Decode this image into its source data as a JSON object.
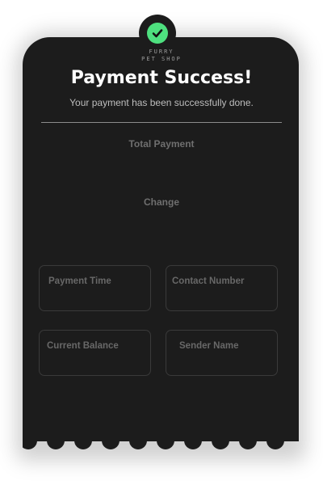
{
  "brand": {
    "line1": "FURRY",
    "line2": "PET SHOP"
  },
  "header": {
    "title": "Payment Success!",
    "subtitle": "Your payment has been successfully done."
  },
  "summary": {
    "total_label": "Total Payment",
    "change_label": "Change"
  },
  "fields": {
    "payment_time": "Payment Time",
    "contact_number": "Contact Number",
    "current_balance": "Current Balance",
    "sender_name": "Sender Name"
  },
  "colors": {
    "card": "#1c1c1c",
    "accent": "#4ee07f",
    "title": "#ffffff"
  },
  "icons": {
    "success": "check-circle-icon"
  }
}
